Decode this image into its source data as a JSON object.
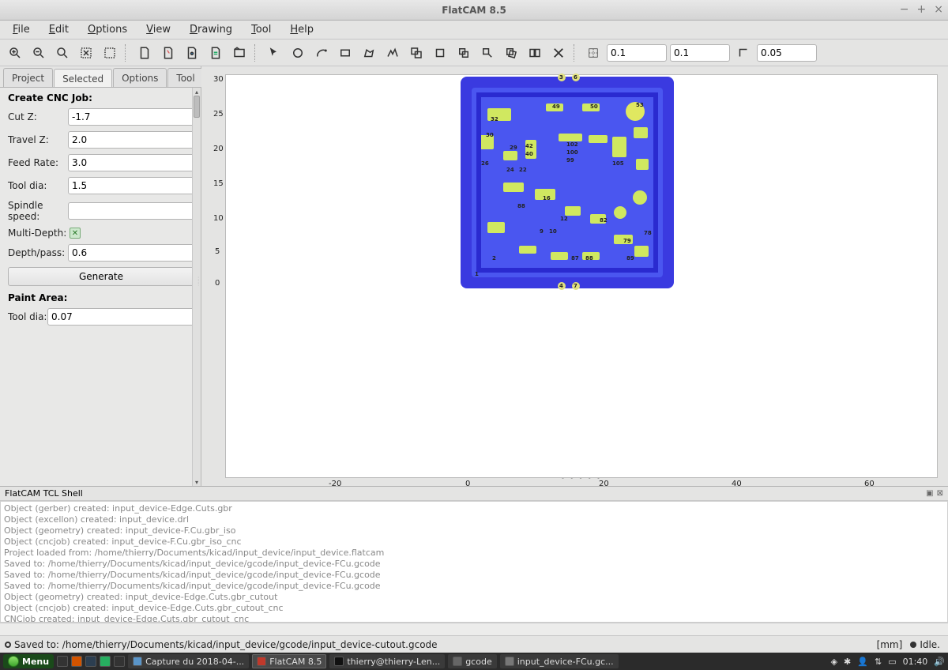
{
  "window": {
    "title": "FlatCAM 8.5"
  },
  "menu": [
    "File",
    "Edit",
    "Options",
    "View",
    "Drawing",
    "Tool",
    "Help"
  ],
  "toolbar_fields": {
    "snap_x": "0.1",
    "snap_y": "0.1",
    "tol": "0.05"
  },
  "tabs": {
    "items": [
      "Project",
      "Selected",
      "Options",
      "Tool"
    ],
    "active": 1
  },
  "sidebar": {
    "section_title": "Create CNC Job:",
    "cutz_label": "Cut Z:",
    "cutz": "-1.7",
    "travelz_label": "Travel Z:",
    "travelz": "2.0",
    "feed_label": "Feed Rate:",
    "feed": "3.0",
    "tooldia_label": "Tool dia:",
    "tooldia": "1.5",
    "spindle_label": "Spindle speed:",
    "spindle": "",
    "multidepth_label": "Multi-Depth:",
    "multidepth_checked": true,
    "depthpass_label": "Depth/pass:",
    "depthpass": "0.6",
    "generate_label": "Generate",
    "paint_title": "Paint Area:",
    "tooldia2_label": "Tool dia:",
    "tooldia2": "0.07"
  },
  "axes": {
    "y": [
      "30",
      "25",
      "20",
      "15",
      "10",
      "5",
      "0"
    ],
    "x": [
      "-20",
      "0",
      "20",
      "40",
      "60"
    ]
  },
  "shell": {
    "title": "FlatCAM TCL Shell",
    "lines": [
      "Object (gerber) created: input_device-Edge.Cuts.gbr",
      "Object (excellon) created: input_device.drl",
      "Object (geometry) created: input_device-F.Cu.gbr_iso",
      "Object (cncjob) created: input_device-F.Cu.gbr_iso_cnc",
      "Project loaded from: /home/thierry/Documents/kicad/input_device/input_device.flatcam",
      "Saved to: /home/thierry/Documents/kicad/input_device/gcode/input_device-FCu.gcode",
      "Saved to: /home/thierry/Documents/kicad/input_device/gcode/input_device-FCu.gcode",
      "Saved to: /home/thierry/Documents/kicad/input_device/gcode/input_device-FCu.gcode",
      "Object (geometry) created: input_device-Edge.Cuts.gbr_cutout",
      "Object (cncjob) created: input_device-Edge.Cuts.gbr_cutout_cnc",
      "CNCjob created: input_device-Edge.Cuts.gbr_cutout_cnc",
      "Saved to: /home/thierry/Documents/kicad/input_device/gcode/input_device-cutout.gcode"
    ]
  },
  "status": {
    "saved": "Saved to: /home/thierry/Documents/kicad/input_device/gcode/input_device-cutout.gcode",
    "units": "[mm]",
    "state": "Idle."
  },
  "taskbar": {
    "menu": "Menu",
    "items": [
      {
        "label": "Capture du 2018-04-..."
      },
      {
        "label": "FlatCAM 8.5",
        "active": true
      },
      {
        "label": "thierry@thierry-Len..."
      },
      {
        "label": "gcode"
      },
      {
        "label": "input_device-FCu.gc..."
      }
    ],
    "clock": "01:40"
  }
}
